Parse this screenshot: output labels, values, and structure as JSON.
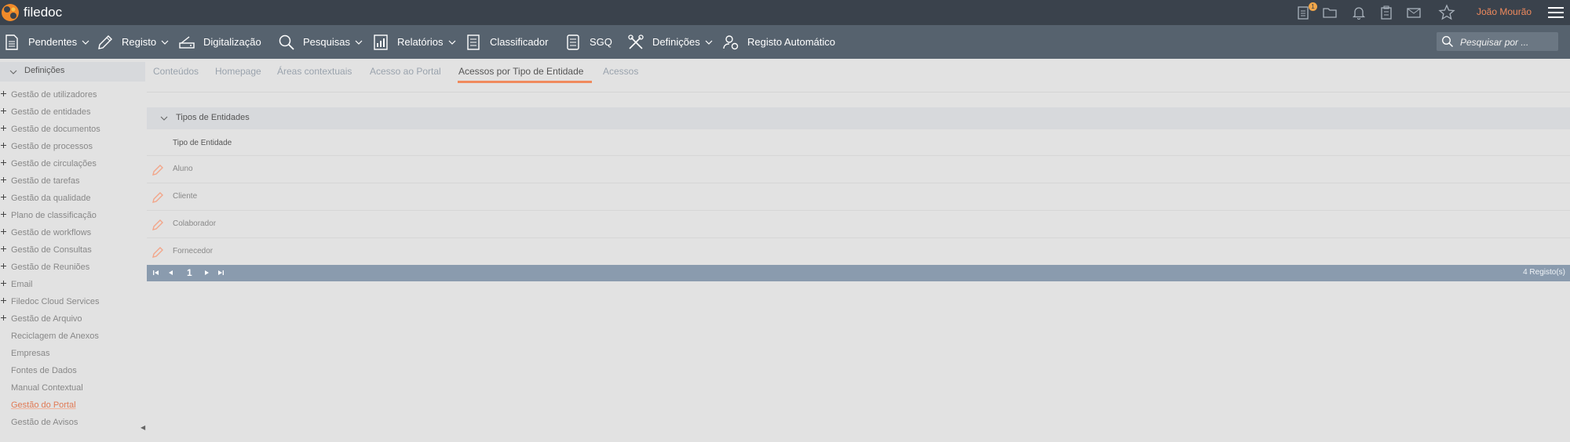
{
  "app": {
    "title": "filedoc",
    "user": "João Mourão",
    "notification_count": "1"
  },
  "nav": {
    "items": [
      {
        "label": "Pendentes",
        "icon": "document-icon",
        "dropdown": true
      },
      {
        "label": "Registo",
        "icon": "pencil-icon",
        "dropdown": true
      },
      {
        "label": "Digitalização",
        "icon": "scanner-icon",
        "dropdown": false
      },
      {
        "label": "Pesquisas",
        "icon": "search-icon",
        "dropdown": true
      },
      {
        "label": "Relatórios",
        "icon": "report-icon",
        "dropdown": true
      },
      {
        "label": "Classificador",
        "icon": "archive-icon",
        "dropdown": false
      },
      {
        "label": "SGQ",
        "icon": "checklist-icon",
        "dropdown": false
      },
      {
        "label": "Definições",
        "icon": "tools-icon",
        "dropdown": true
      },
      {
        "label": "Registo Automático",
        "icon": "auto-register-icon",
        "dropdown": false
      }
    ],
    "search_placeholder": "Pesquisar por ..."
  },
  "sidebar": {
    "header": "Definições",
    "items": [
      {
        "label": "Gestão de utilizadores",
        "expandable": true
      },
      {
        "label": "Gestão de entidades",
        "expandable": true
      },
      {
        "label": "Gestão de documentos",
        "expandable": true
      },
      {
        "label": "Gestão de processos",
        "expandable": true
      },
      {
        "label": "Gestão de circulações",
        "expandable": true
      },
      {
        "label": "Gestão de tarefas",
        "expandable": true
      },
      {
        "label": "Gestão da qualidade",
        "expandable": true
      },
      {
        "label": "Plano de classificação",
        "expandable": true
      },
      {
        "label": "Gestão de workflows",
        "expandable": true
      },
      {
        "label": "Gestão de Consultas",
        "expandable": true
      },
      {
        "label": "Gestão de Reuniões",
        "expandable": true
      },
      {
        "label": "Email",
        "expandable": true
      },
      {
        "label": "Filedoc Cloud Services",
        "expandable": true
      },
      {
        "label": "Gestão de Arquivo",
        "expandable": true
      },
      {
        "label": "Reciclagem de Anexos",
        "expandable": false
      },
      {
        "label": "Empresas",
        "expandable": false
      },
      {
        "label": "Fontes de Dados",
        "expandable": false
      },
      {
        "label": "Manual Contextual",
        "expandable": false
      },
      {
        "label": "Gestão do Portal",
        "expandable": false,
        "active": true
      },
      {
        "label": "Gestão de Avisos",
        "expandable": false
      }
    ]
  },
  "tabs": [
    {
      "label": "Conteúdos"
    },
    {
      "label": "Homepage"
    },
    {
      "label": "Áreas contextuais"
    },
    {
      "label": "Acesso ao Portal"
    },
    {
      "label": "Acessos por Tipo de Entidade",
      "active": true
    },
    {
      "label": "Acessos"
    }
  ],
  "panel": {
    "title": "Tipos de Entidades",
    "column_header": "Tipo de Entidade",
    "rows": [
      "Aluno",
      "Cliente",
      "Colaborador",
      "Fornecedor"
    ],
    "pager": {
      "page": "1",
      "count": "4 Registo(s)"
    }
  },
  "colors": {
    "accent": "#f08a5d",
    "topbar": "#3a424c",
    "navbar": "#56626e",
    "pager": "#8a9bae"
  }
}
